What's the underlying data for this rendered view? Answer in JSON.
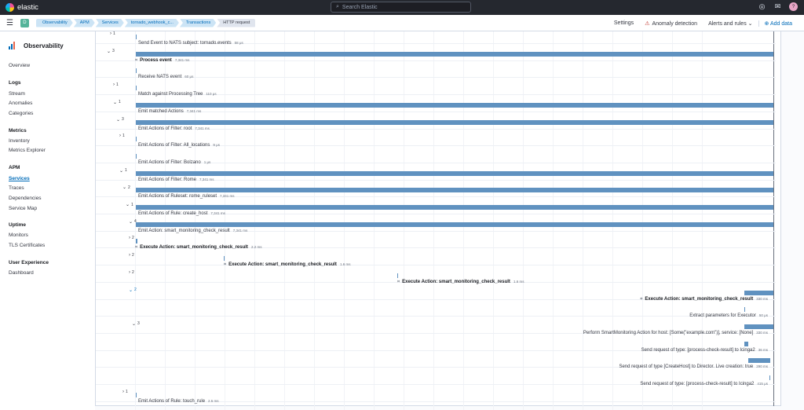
{
  "app": {
    "logo_text": "elastic",
    "search_placeholder": "Search Elastic",
    "avatar_initial": "?"
  },
  "breadcrumbs": [
    "Observability",
    "APM",
    "Services",
    "tornado_webhook_c...",
    "Transactions",
    "HTTP request"
  ],
  "space_initial": "D",
  "header_actions": {
    "settings": "Settings",
    "anomaly": "Anomaly detection",
    "alerts": "Alerts and rules",
    "add_data": "Add data"
  },
  "sidebar": {
    "title": "Observability",
    "overview": "Overview",
    "logs": "Logs",
    "stream": "Stream",
    "anomalies": "Anomalies",
    "categories": "Categories",
    "metrics": "Metrics",
    "inventory": "Inventory",
    "metrics_explorer": "Metrics Explorer",
    "apm": "APM",
    "services": "Services",
    "traces": "Traces",
    "dependencies": "Dependencies",
    "service_map": "Service Map",
    "uptime": "Uptime",
    "monitors": "Monitors",
    "tls": "TLS Certificates",
    "ux": "User Experience",
    "dashboard": "Dashboard"
  },
  "spans": [
    {
      "label": "Send Event to NATS subject: tornado.events",
      "duration": "58 μs",
      "toggle": "1",
      "expanded": false,
      "bold": false
    },
    {
      "label": "Process event",
      "duration": "7,341 ms",
      "toggle": "3",
      "expanded": true,
      "bold": true
    },
    {
      "label": "Receive NATS event",
      "duration": "60 μs",
      "toggle": "",
      "expanded": false,
      "bold": false
    },
    {
      "label": "Match against Processing Tree",
      "duration": "110 μs",
      "toggle": "1",
      "expanded": false,
      "bold": false
    },
    {
      "label": "Emit matched Actions",
      "duration": "7,341 ms",
      "toggle": "1",
      "expanded": true,
      "bold": false
    },
    {
      "label": "Emit Actions of Filter: root",
      "duration": "7,341 ms",
      "toggle": "3",
      "expanded": true,
      "bold": false
    },
    {
      "label": "Emit Actions of Filter: All_locations",
      "duration": "9 μs",
      "toggle": "1",
      "expanded": false,
      "bold": false
    },
    {
      "label": "Emit Actions of Filter: Bolzano",
      "duration": "1 μs",
      "toggle": "",
      "expanded": false,
      "bold": false
    },
    {
      "label": "Emit Actions of Filter: Rome",
      "duration": "7,341 ms",
      "toggle": "1",
      "expanded": true,
      "bold": false
    },
    {
      "label": "Emit Actions of Ruleset: rome_ruleset",
      "duration": "7,341 ms",
      "toggle": "2",
      "expanded": true,
      "bold": false
    },
    {
      "label": "Emit Actions of Rule: create_host",
      "duration": "7,341 ms",
      "toggle": "1",
      "expanded": true,
      "bold": false
    },
    {
      "label": "Emit Action: smart_monitoring_check_result",
      "duration": "7,341 ms",
      "toggle": "4",
      "expanded": true,
      "bold": false
    },
    {
      "label": "Execute Action: smart_monitoring_check_result",
      "duration": "2.2 ms",
      "toggle": "2",
      "expanded": false,
      "bold": true
    },
    {
      "label": "Execute Action: smart_monitoring_check_result",
      "duration": "1.6 ms",
      "toggle": "2",
      "expanded": false,
      "bold": true
    },
    {
      "label": "Execute Action: smart_monitoring_check_result",
      "duration": "1.6 ms",
      "toggle": "2",
      "expanded": false,
      "bold": true
    },
    {
      "label": "Execute Action: smart_monitoring_check_result",
      "duration": "330 ms",
      "toggle": "2",
      "expanded": true,
      "bold": true
    },
    {
      "label": "Extract parameters for Executor",
      "duration": "50 μs",
      "toggle": "",
      "expanded": false,
      "bold": false
    },
    {
      "label": "Perform SmartMonitoring Action for host: [Some(\"example.com\")], service: [None]",
      "duration": "330 ms",
      "toggle": "3",
      "expanded": true,
      "bold": false
    },
    {
      "label": "Send request of type: [process-check-result] to Icinga2",
      "duration": "36 ms",
      "toggle": "",
      "expanded": false,
      "bold": false
    },
    {
      "label": "Send request of type [CreateHost] to Director. Live creation: true",
      "duration": "290 ms",
      "toggle": "",
      "expanded": false,
      "bold": false
    },
    {
      "label": "Send request of type: [process-check-result] to Icinga2",
      "duration": "415 μs",
      "toggle": "",
      "expanded": false,
      "bold": false
    },
    {
      "label": "Emit Actions of Rule: touch_rule",
      "duration": "2.5 ms",
      "toggle": "1",
      "expanded": false,
      "bold": false
    }
  ]
}
